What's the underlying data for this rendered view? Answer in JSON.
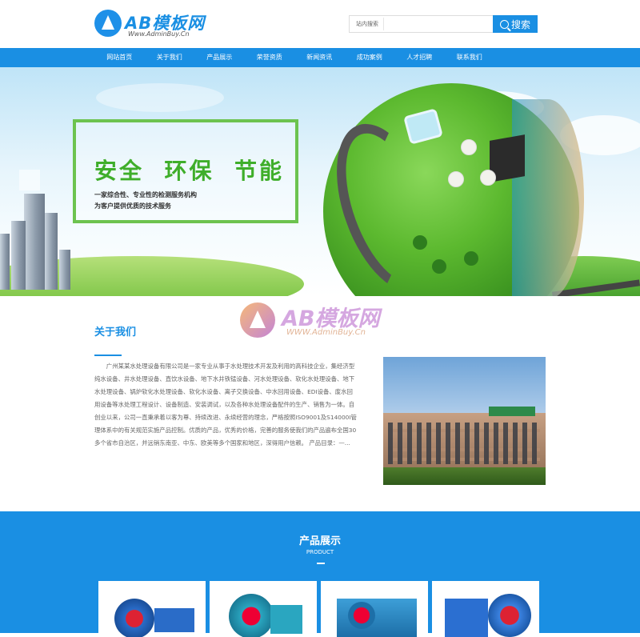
{
  "logo": {
    "text": "AB模板网",
    "sub": "Www.AdminBuy.Cn"
  },
  "search": {
    "label": "站内搜索",
    "placeholder": "",
    "button": "搜索"
  },
  "nav": {
    "items": [
      "网站首页",
      "关于我们",
      "产品展示",
      "荣誉资质",
      "新闻资讯",
      "成功案例",
      "人才招聘",
      "联系我们"
    ]
  },
  "banner": {
    "title": "安全  环保  节能",
    "line1": "一家综合性、专业性的检测服务机构",
    "line2": "为客户提供优质的技术服务"
  },
  "about": {
    "title": "关于我们",
    "text": "广州某某水处理设备有限公司是一家专业从事于水处理技术开发及利用的高科技企业，集经济型纯水设备、井水处理设备、直饮水设备、地下水井铁锰设备、河水处理设备、软化水处理设备、地下水处理设备、锅炉软化水处理设备、软化水设备、离子交换设备、中水回用设备、EDI设备、废水回用设备等水处理工程设计、设备制造、安装调试，以及各种水处理设备配件的生产、销售为一体。自创业以来，公司一直秉承着以客为尊、持续改进、永续经营的理念，严格按照ISO9001及S14000I管理体系中的有关规范实施产品控制。优质的产品，优秀的价格，完善的服务使我们的产品遍布全国30多个省市自治区，并远销东南亚、中东、欧美等多个国家和地区，深得用户信赖。 产品目录：—..."
  },
  "watermark": {
    "text": "AB模板网",
    "sub": "WWW.AdminBuy.Cn"
  },
  "products": {
    "title": "产品展示",
    "subtitle": "PRODUCT"
  },
  "colors": {
    "brand": "#1a8fe3",
    "green": "#3fae2a"
  }
}
